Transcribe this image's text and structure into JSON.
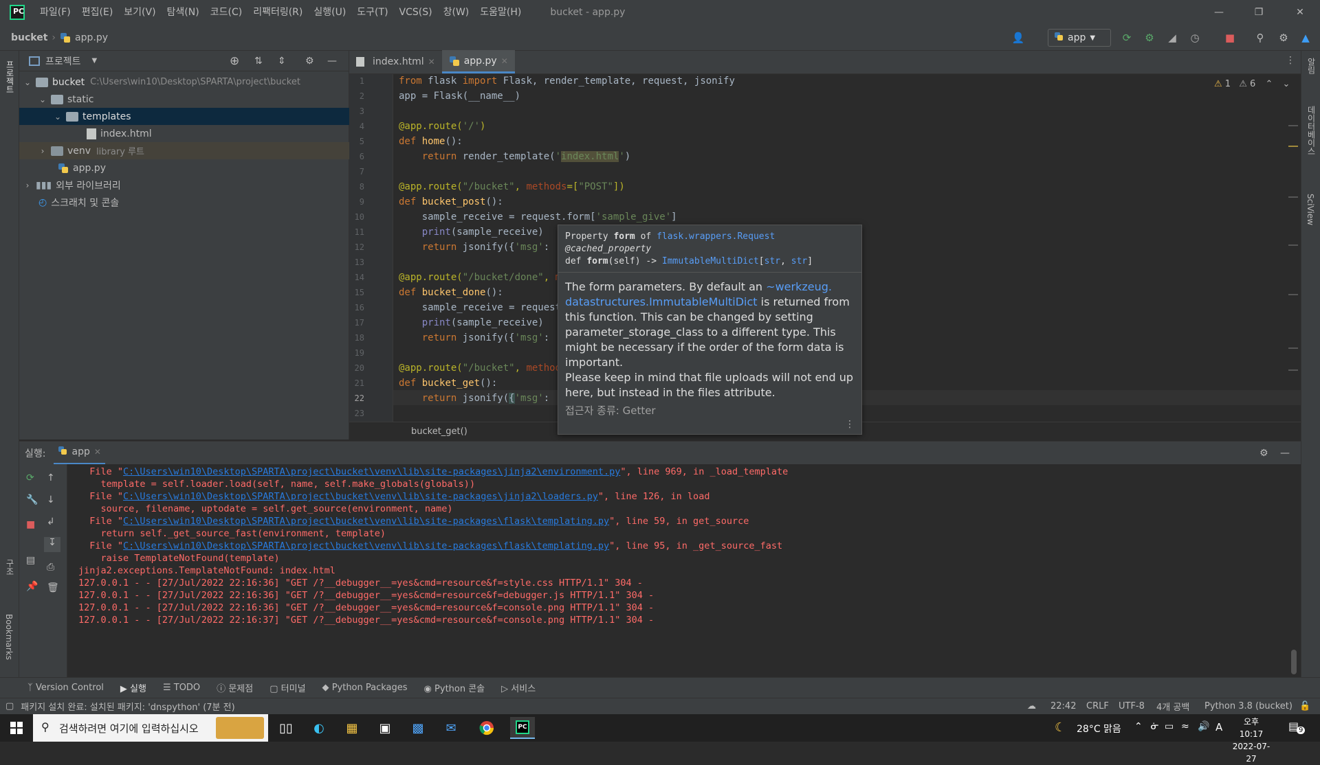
{
  "window": {
    "title": "bucket - app.py",
    "menu": [
      "파일(F)",
      "편집(E)",
      "보기(V)",
      "탐색(N)",
      "코드(C)",
      "리팩터링(R)",
      "실행(U)",
      "도구(T)",
      "VCS(S)",
      "창(W)",
      "도움말(H)"
    ]
  },
  "navbar": {
    "project": "bucket",
    "file": "app.py",
    "run_config": "app"
  },
  "left_strip": {
    "project_label": "프로젝트",
    "structure_label": "구조",
    "bookmarks_label": "Bookmarks"
  },
  "right_strip": {
    "notifications_label": "알림",
    "database_label": "데이터베이스",
    "sciview_label": "SciView"
  },
  "project_panel": {
    "title": "프로젝트",
    "tree": {
      "root_name": "bucket",
      "root_path": "C:\\Users\\win10\\Desktop\\SPARTA\\project\\bucket",
      "static": "static",
      "templates": "templates",
      "index_html": "index.html",
      "venv": "venv",
      "venv_hint": "library 루트",
      "app_py": "app.py",
      "external_libs": "외부 라이브러리",
      "scratches": "스크래치 및 콘솔"
    }
  },
  "editor": {
    "tabs": [
      {
        "label": "index.html"
      },
      {
        "label": "app.py"
      }
    ],
    "inspection": {
      "warnings": "1",
      "weak_warnings": "6"
    },
    "breadcrumb": "bucket_get()",
    "line_numbers": [
      "1",
      "2",
      "3",
      "4",
      "5",
      "6",
      "7",
      "8",
      "9",
      "10",
      "11",
      "12",
      "13",
      "14",
      "15",
      "16",
      "17",
      "18",
      "19",
      "20",
      "21",
      "22",
      "23"
    ]
  },
  "doc_popup": {
    "sig_line1_prefix": "Property ",
    "sig_line1_bold": "form",
    "sig_line1_mid": " of ",
    "sig_line1_link": "flask.wrappers.Request",
    "sig_line2": "@cached_property",
    "sig_line3_prefix": "def ",
    "sig_line3_bold": "form",
    "sig_line3_mid": "(self) -> ",
    "sig_line3_link": "ImmutableMultiDict",
    "sig_line3_args_open": "[",
    "sig_line3_arg1": "str",
    "sig_line3_sep": ", ",
    "sig_line3_arg2": "str",
    "sig_line3_close": "]",
    "body_1": "The form parameters. By default an ",
    "body_link1": "~werkzeug.",
    "body_link2": "datastructures.ImmutableMultiDict",
    "body_2": " is returned from this function. This can be changed by setting parameter_storage_class to a different type. This might be necessary if the order of the form data is important.",
    "body_3": "Please keep in mind that file uploads will not end up here, but instead in the files attribute.",
    "footer": "접근자 종류: Getter"
  },
  "run_panel": {
    "label": "실행:",
    "tab": "app",
    "lines": [
      {
        "type": "file",
        "pre": "  File \"",
        "link": "C:\\Users\\win10\\Desktop\\SPARTA\\project\\bucket\\venv\\lib\\site-packages\\jinja2\\environment.py",
        "post": "\", line 969, in _load_template"
      },
      {
        "type": "err",
        "text": "    template = self.loader.load(self, name, self.make_globals(globals))"
      },
      {
        "type": "file",
        "pre": "  File \"",
        "link": "C:\\Users\\win10\\Desktop\\SPARTA\\project\\bucket\\venv\\lib\\site-packages\\jinja2\\loaders.py",
        "post": "\", line 126, in load"
      },
      {
        "type": "err",
        "text": "    source, filename, uptodate = self.get_source(environment, name)"
      },
      {
        "type": "file",
        "pre": "  File \"",
        "link": "C:\\Users\\win10\\Desktop\\SPARTA\\project\\bucket\\venv\\lib\\site-packages\\flask\\templating.py",
        "post": "\", line 59, in get_source"
      },
      {
        "type": "err",
        "text": "    return self._get_source_fast(environment, template)"
      },
      {
        "type": "file",
        "pre": "  File \"",
        "link": "C:\\Users\\win10\\Desktop\\SPARTA\\project\\bucket\\venv\\lib\\site-packages\\flask\\templating.py",
        "post": "\", line 95, in _get_source_fast"
      },
      {
        "type": "err",
        "text": "    raise TemplateNotFound(template)"
      },
      {
        "type": "err",
        "text": "jinja2.exceptions.TemplateNotFound: index.html"
      },
      {
        "type": "err",
        "text": "127.0.0.1 - - [27/Jul/2022 22:16:36] \"GET /?__debugger__=yes&cmd=resource&f=style.css HTTP/1.1\" 304 -"
      },
      {
        "type": "err",
        "text": "127.0.0.1 - - [27/Jul/2022 22:16:36] \"GET /?__debugger__=yes&cmd=resource&f=debugger.js HTTP/1.1\" 304 -"
      },
      {
        "type": "err",
        "text": "127.0.0.1 - - [27/Jul/2022 22:16:36] \"GET /?__debugger__=yes&cmd=resource&f=console.png HTTP/1.1\" 304 -"
      },
      {
        "type": "err",
        "text": "127.0.0.1 - - [27/Jul/2022 22:16:37] \"GET /?__debugger__=yes&cmd=resource&f=console.png HTTP/1.1\" 304 -"
      }
    ]
  },
  "toolwindows": [
    "Version Control",
    "실행",
    "TODO",
    "문제점",
    "터미널",
    "Python Packages",
    "Python 콘솔",
    "서비스"
  ],
  "statusbar": {
    "message": "패키지 설치 완료: 설치된 패키지: 'dnspython' (7분 전)",
    "position": "22:42",
    "line_sep": "CRLF",
    "encoding": "UTF-8",
    "indent": "4개 공백",
    "interpreter": "Python 3.8 (bucket)"
  },
  "taskbar": {
    "search_placeholder": "검색하려면 여기에 입력하십시오",
    "weather": "28°C 맑음",
    "ime": "A",
    "time": "오후 10:17",
    "date": "2022-07-27",
    "notif_count": "9"
  },
  "colors": {
    "accent": "#4a88c7",
    "error": "#ff6b68",
    "link": "#287bde",
    "keyword": "#cc7832",
    "string": "#6a8759",
    "decorator": "#bbb529"
  }
}
